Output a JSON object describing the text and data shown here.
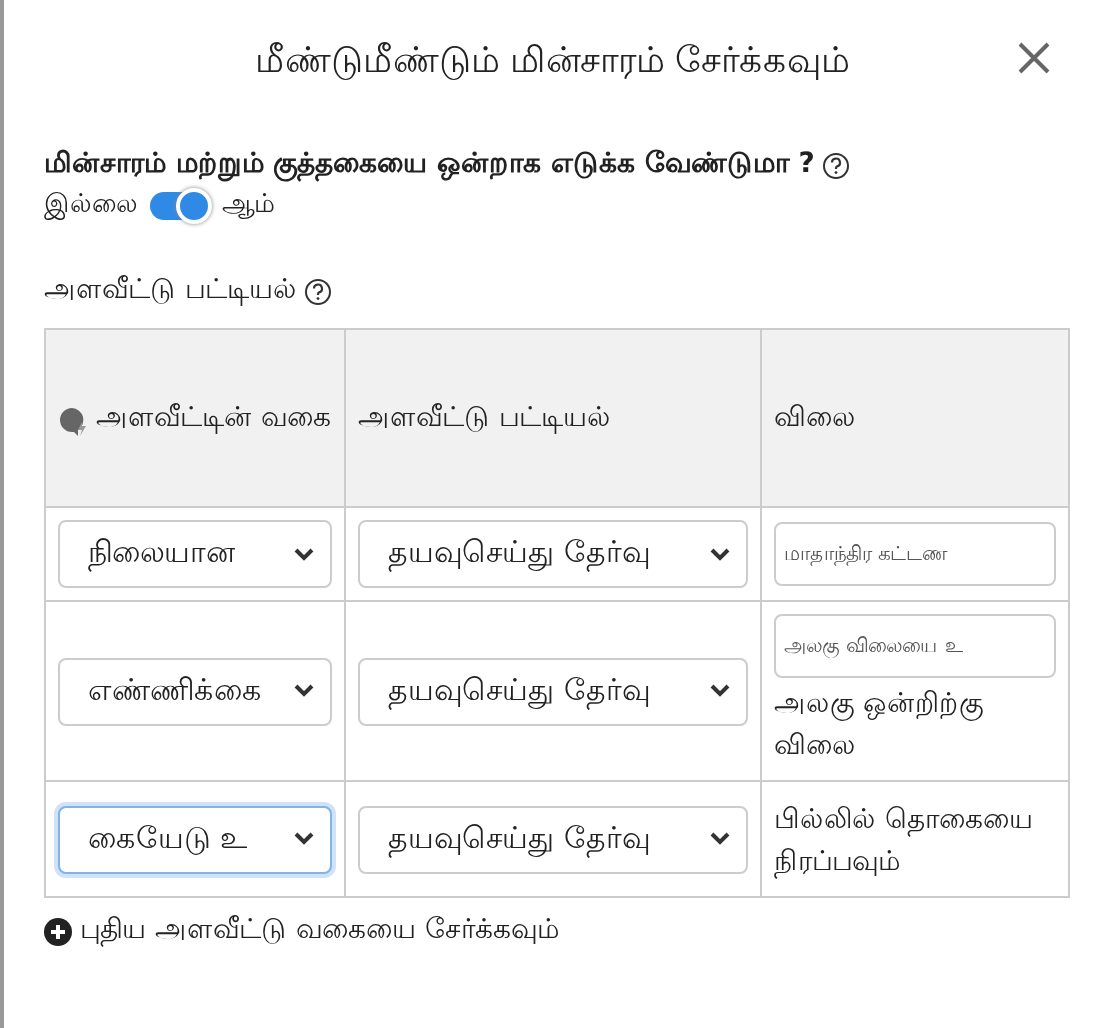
{
  "dialog": {
    "title": "மீண்டுமீண்டும் மின்சாரம் சேர்க்கவும்"
  },
  "question": {
    "label": "மின்சாரம் மற்றும் குத்தகையை ஒன்றாக எடுக்க வேண்டுமா ?",
    "off_label": "இல்லை",
    "on_label": "ஆம்",
    "on": true
  },
  "section": {
    "title": "அளவீட்டு பட்டியல்"
  },
  "table": {
    "columns": [
      "அளவீட்டின் வகை",
      "அளவீட்டு பட்டியல்",
      "விலை"
    ],
    "rows": [
      {
        "type": {
          "value": "நிலையான",
          "focused": false
        },
        "metric": {
          "value": "தயவுசெய்து தேர்வு",
          "focused": false
        },
        "price": {
          "placeholder": "மாதாந்திர கட்டண"
        }
      },
      {
        "type": {
          "value": "எண்ணிக்கை",
          "focused": false
        },
        "metric": {
          "value": "தயவுசெய்து தேர்வு",
          "focused": false
        },
        "price": {
          "placeholder": "அலகு விலையை உ",
          "note": "அலகு ஒன்றிற்கு விலை"
        }
      },
      {
        "type": {
          "value": "கையேடு உ",
          "focused": true
        },
        "metric": {
          "value": "தயவுசெய்து தேர்வு",
          "focused": false
        },
        "price": {
          "note": "பில்லில் தொகையை நிரப்பவும்"
        }
      }
    ]
  },
  "add_link": "புதிய அளவீட்டு வகையை சேர்க்கவும்"
}
